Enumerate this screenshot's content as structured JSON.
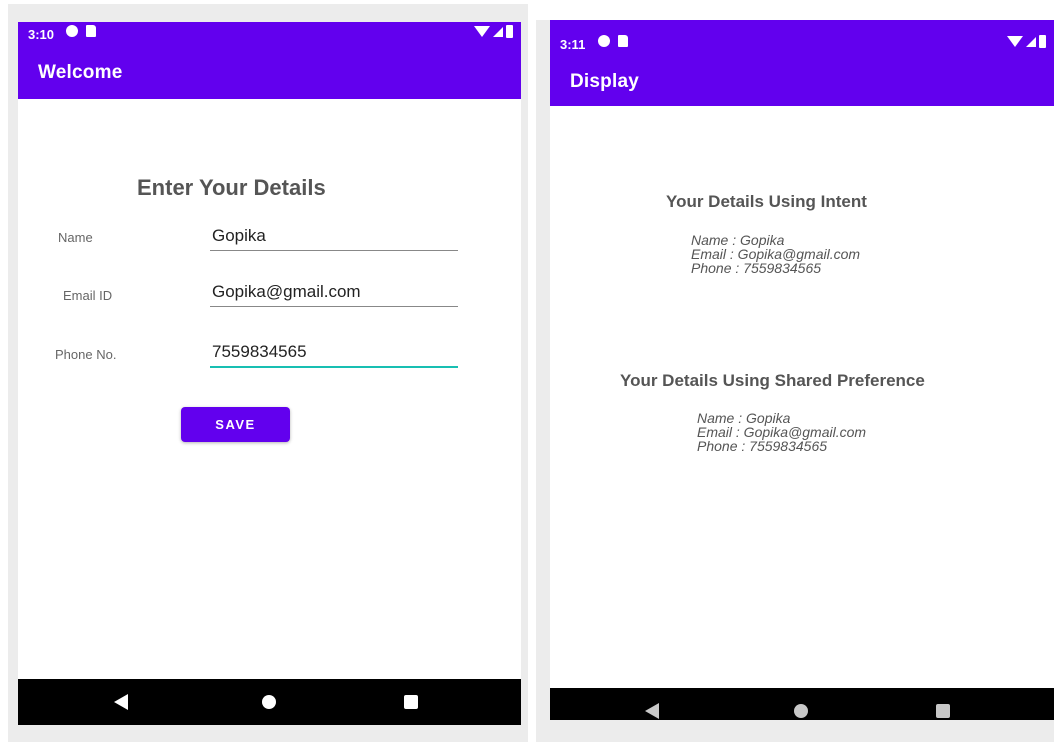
{
  "welcome_screen": {
    "status_bar": {
      "time": "3:10"
    },
    "app_bar": {
      "title": "Welcome"
    },
    "heading": "Enter Your Details",
    "form": {
      "name_label": "Name",
      "name_value": "Gopika",
      "email_label": "Email ID",
      "email_value": "Gopika@gmail.com",
      "phone_label": "Phone No.",
      "phone_value": "7559834565"
    },
    "save_label": "SAVE"
  },
  "display_screen": {
    "status_bar": {
      "time": "3:11"
    },
    "app_bar": {
      "title": "Display"
    },
    "intent_heading": "Your Details Using Intent",
    "intent_details": {
      "name": "Name : Gopika",
      "email": "Email : Gopika@gmail.com",
      "phone": "Phone : 7559834565"
    },
    "shared_heading": "Your Details Using Shared Preference",
    "shared_details": {
      "name": "Name : Gopika",
      "email": "Email : Gopika@gmail.com",
      "phone": "Phone : 7559834565"
    }
  },
  "theme": {
    "primary": "#6200ee",
    "accent": "#18bfb2"
  },
  "icons": {
    "status_left": [
      "privacy-indicator-icon",
      "sd-card-icon"
    ],
    "status_right": [
      "wifi-icon",
      "cell-signal-icon",
      "battery-icon"
    ],
    "nav": [
      "back-icon",
      "home-icon",
      "recents-icon"
    ]
  }
}
